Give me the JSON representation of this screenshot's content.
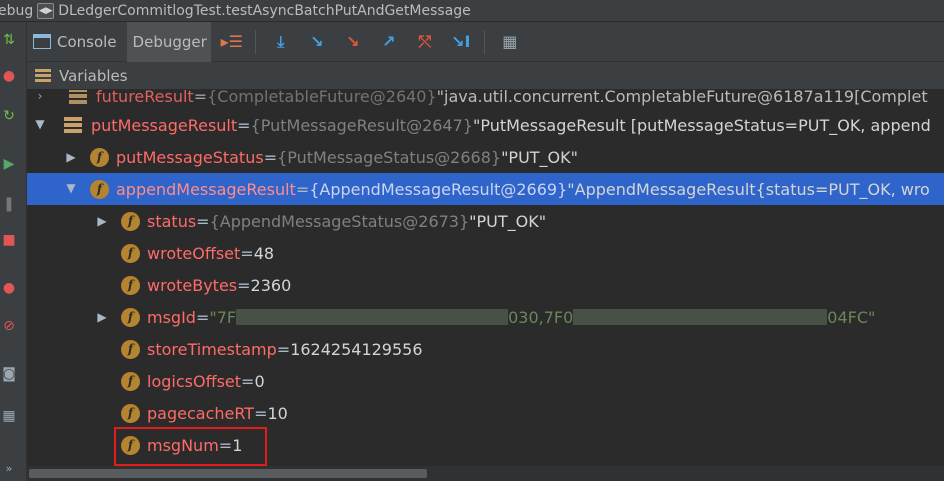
{
  "titlebar": {
    "prefix": "ebug",
    "config_name": "DLedgerCommitlogTest.testAsyncBatchPutAndGetMessage"
  },
  "tabs": {
    "console": "Console",
    "debugger": "Debugger"
  },
  "toolbar_icons": [
    "restore-layout-icon",
    "show-execution-point-icon",
    "step-over-icon",
    "step-into-icon",
    "force-step-into-icon",
    "step-out-icon",
    "drop-frame-icon",
    "run-to-cursor-icon",
    "evaluate-expression-icon"
  ],
  "variables_header": "Variables",
  "tree": {
    "partial_row": {
      "name": "futureResult",
      "type": "{CompletableFuture@2640}",
      "value": "\"java.util.concurrent.CompletableFuture@6187a119[Complet"
    },
    "rows": [
      {
        "name": "putMessageResult",
        "eq": " = ",
        "type": "{PutMessageResult@2647}",
        "value": " \"PutMessageResult [putMessageStatus=PUT_OK, append"
      },
      {
        "name": "putMessageStatus",
        "eq": " = ",
        "type": "{PutMessageStatus@2668}",
        "value": " \"PUT_OK\""
      },
      {
        "name": "appendMessageResult",
        "eq": " = ",
        "type": "{AppendMessageResult@2669}",
        "value": " \"AppendMessageResult{status=PUT_OK, wro"
      },
      {
        "name": "status",
        "eq": " = ",
        "type": "{AppendMessageStatus@2673}",
        "value": " \"PUT_OK\""
      },
      {
        "name": "wroteOffset",
        "eq": " = ",
        "value": "48"
      },
      {
        "name": "wroteBytes",
        "eq": " = ",
        "value": "2360"
      },
      {
        "name": "msgId",
        "eq": " = ",
        "value_start": "\"7F",
        "value_mid": "030,7F0",
        "value_end": "04FC\""
      },
      {
        "name": "storeTimestamp",
        "eq": " = ",
        "value": "1624254129556"
      },
      {
        "name": "logicsOffset",
        "eq": " = ",
        "value": "0"
      },
      {
        "name": "pagecacheRT",
        "eq": " = ",
        "value": "10"
      },
      {
        "name": "msgNum",
        "eq": " = ",
        "value": "1"
      }
    ]
  },
  "colors": {
    "background": "#2b2b2b",
    "selection": "#2f65ca",
    "field_name": "#ff6b68",
    "string_value": "#6a8759",
    "highlight_box": "#e21b1b"
  }
}
